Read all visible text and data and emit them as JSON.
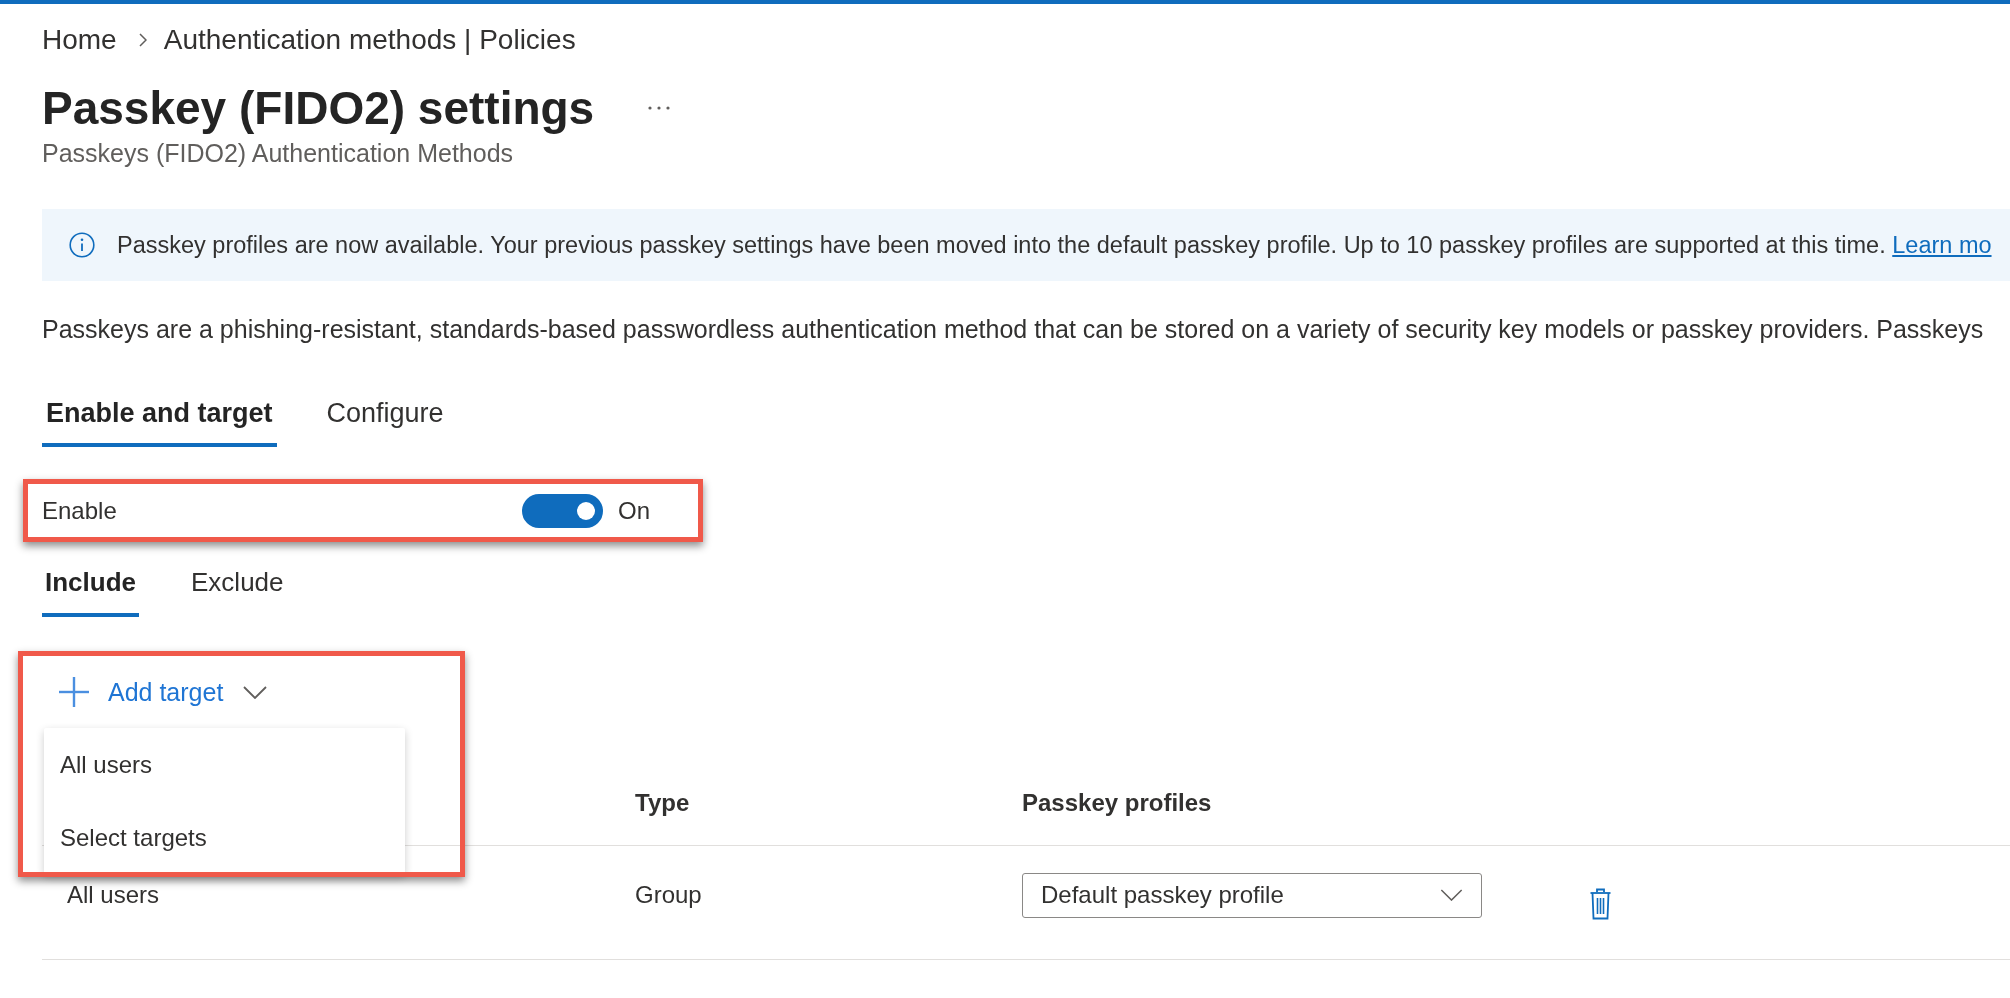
{
  "breadcrumb": [
    "Home",
    "Authentication methods | Policies"
  ],
  "page": {
    "title": "Passkey (FIDO2) settings",
    "subtitle": "Passkeys (FIDO2) Authentication Methods"
  },
  "info_banner": {
    "text": "Passkey profiles are now available. Your previous passkey settings have been moved into the default passkey profile. Up to 10 passkey profiles are supported at this time.",
    "link": "Learn mo"
  },
  "description": "Passkeys are a phishing-resistant, standards-based passwordless authentication method that can be stored on a variety of security key models or passkey providers. Passkeys",
  "tabs": [
    {
      "label": "Enable and target",
      "selected": true
    },
    {
      "label": "Configure",
      "selected": false
    }
  ],
  "enable": {
    "label": "Enable",
    "on": true,
    "state_label": "On"
  },
  "target_tabs": [
    {
      "label": "Include",
      "selected": true
    },
    {
      "label": "Exclude",
      "selected": false
    }
  ],
  "add_target": {
    "label": "Add target",
    "expanded": true,
    "menu": [
      "All users",
      "Select targets"
    ]
  },
  "table": {
    "columns": {
      "type": "Type",
      "passkey_profiles": "Passkey profiles"
    },
    "rows": [
      {
        "column_1": "All users",
        "type": "Group",
        "passkey_profile": "Default passkey profile"
      }
    ]
  }
}
